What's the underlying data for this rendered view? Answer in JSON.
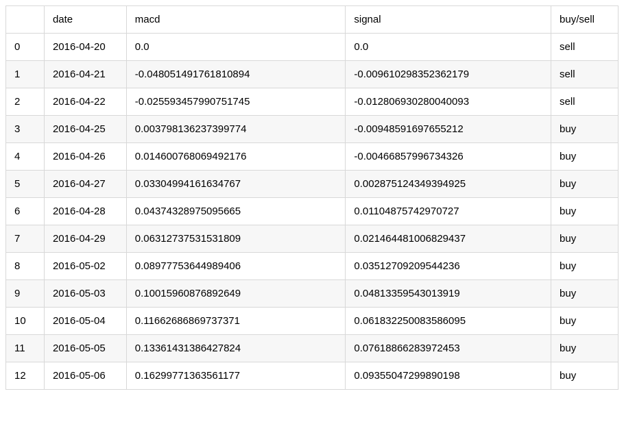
{
  "chart_data": {
    "type": "table",
    "columns": [
      "",
      "date",
      "macd",
      "signal",
      "buy/sell"
    ],
    "rows": [
      {
        "index": "0",
        "date": "2016-04-20",
        "macd": "0.0",
        "signal": "0.0",
        "buysell": "sell"
      },
      {
        "index": "1",
        "date": "2016-04-21",
        "macd": "-0.048051491761810894",
        "signal": "-0.009610298352362179",
        "buysell": "sell"
      },
      {
        "index": "2",
        "date": "2016-04-22",
        "macd": "-0.025593457990751745",
        "signal": "-0.012806930280040093",
        "buysell": "sell"
      },
      {
        "index": "3",
        "date": "2016-04-25",
        "macd": "0.003798136237399774",
        "signal": "-0.00948591697655212",
        "buysell": "buy"
      },
      {
        "index": "4",
        "date": "2016-04-26",
        "macd": "0.014600768069492176",
        "signal": "-0.00466857996734326",
        "buysell": "buy"
      },
      {
        "index": "5",
        "date": "2016-04-27",
        "macd": "0.03304994161634767",
        "signal": "0.002875124349394925",
        "buysell": "buy"
      },
      {
        "index": "6",
        "date": "2016-04-28",
        "macd": "0.04374328975095665",
        "signal": "0.01104875742970727",
        "buysell": "buy"
      },
      {
        "index": "7",
        "date": "2016-04-29",
        "macd": "0.06312737531531809",
        "signal": "0.021464481006829437",
        "buysell": "buy"
      },
      {
        "index": "8",
        "date": "2016-05-02",
        "macd": "0.08977753644989406",
        "signal": "0.03512709209544236",
        "buysell": "buy"
      },
      {
        "index": "9",
        "date": "2016-05-03",
        "macd": "0.10015960876892649",
        "signal": "0.04813359543013919",
        "buysell": "buy"
      },
      {
        "index": "10",
        "date": "2016-05-04",
        "macd": "0.11662686869737371",
        "signal": "0.061832250083586095",
        "buysell": "buy"
      },
      {
        "index": "11",
        "date": "2016-05-05",
        "macd": "0.13361431386427824",
        "signal": "0.07618866283972453",
        "buysell": "buy"
      },
      {
        "index": "12",
        "date": "2016-05-06",
        "macd": "0.16299771363561177",
        "signal": "0.09355047299890198",
        "buysell": "buy"
      }
    ]
  }
}
